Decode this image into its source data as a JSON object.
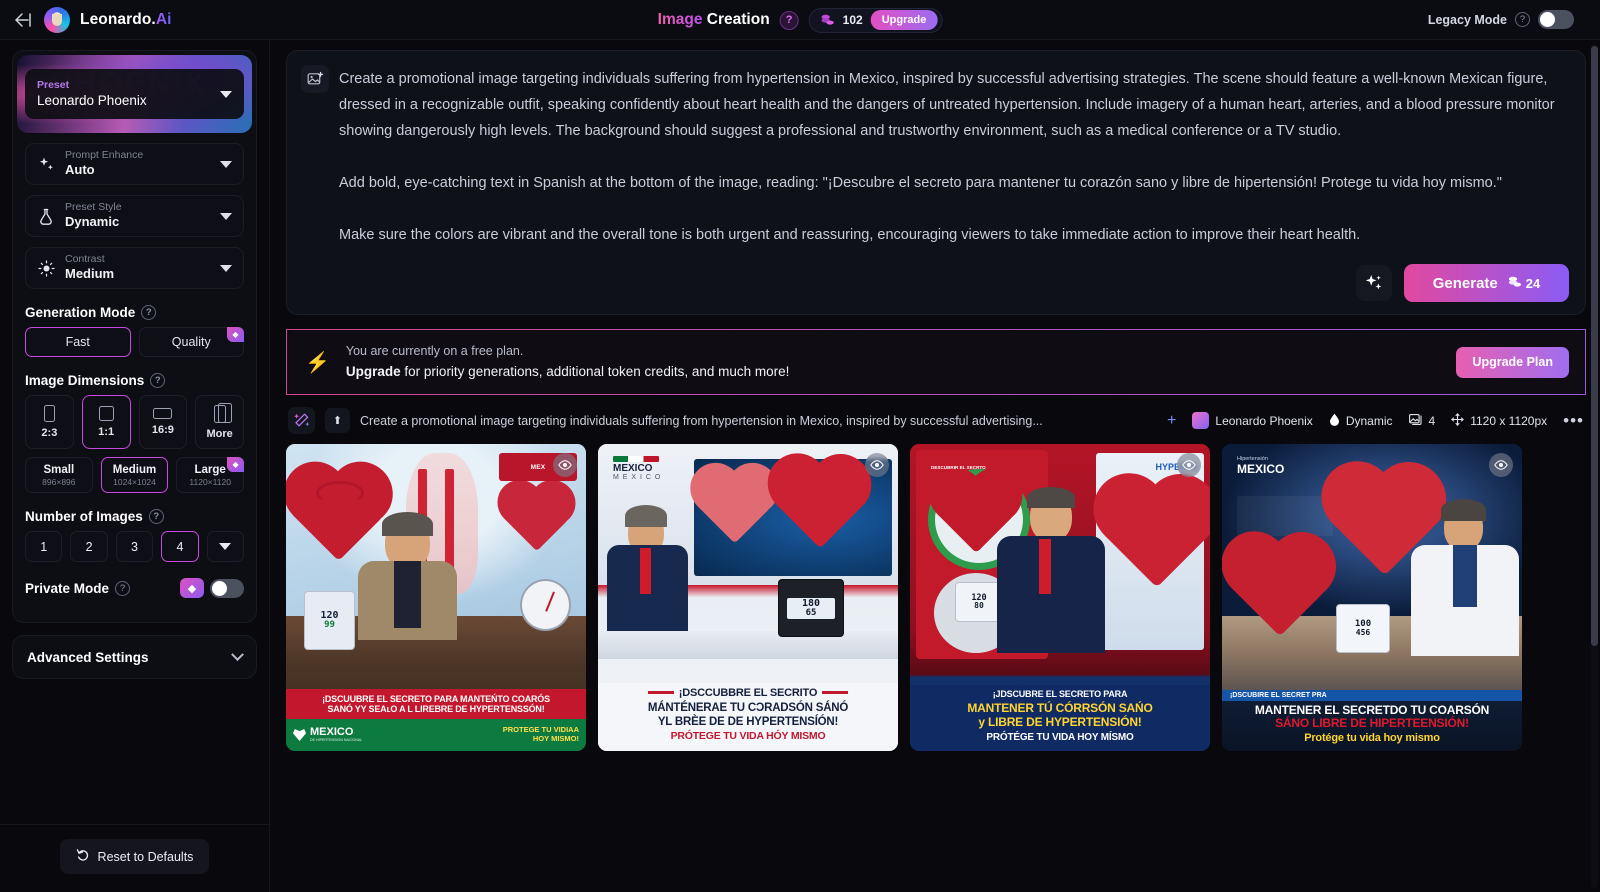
{
  "header": {
    "back_icon": "back-arrow-icon",
    "brand_main": "Leonardo.",
    "brand_accent": "Ai",
    "title_accent": "Image",
    "title_rest": " Creation",
    "help_glyph": "?",
    "token_count": "102",
    "upgrade_label": "Upgrade",
    "legacy_label": "Legacy Mode",
    "legacy_help": "?",
    "legacy_on": false
  },
  "sidebar": {
    "preset": {
      "label": "Preset",
      "value": "Leonardo Phoenix",
      "hero_word": "PHOENIX"
    },
    "selects": [
      {
        "label": "Prompt Enhance",
        "value": "Auto",
        "icon": "sparkle-icon"
      },
      {
        "label": "Preset Style",
        "value": "Dynamic",
        "icon": "flask-icon"
      },
      {
        "label": "Contrast",
        "value": "Medium",
        "icon": "sun-icon"
      }
    ],
    "generation_mode": {
      "title": "Generation Mode",
      "help": "?",
      "options": [
        {
          "label": "Fast",
          "selected": true,
          "premium": false
        },
        {
          "label": "Quality",
          "selected": false,
          "premium": true
        }
      ]
    },
    "image_dimensions": {
      "title": "Image Dimensions",
      "help": "?",
      "ratios": [
        {
          "label": "2:3",
          "selected": false
        },
        {
          "label": "1:1",
          "selected": true
        },
        {
          "label": "16:9",
          "selected": false
        },
        {
          "label": "More",
          "selected": false
        }
      ],
      "sizes": [
        {
          "name": "Small",
          "px": "896×896",
          "selected": false,
          "premium": false
        },
        {
          "name": "Medium",
          "px": "1024×1024",
          "selected": true,
          "premium": false
        },
        {
          "name": "Large",
          "px": "1120×1120",
          "selected": false,
          "premium": true
        }
      ]
    },
    "number_of_images": {
      "title": "Number of Images",
      "help": "?",
      "options": [
        {
          "label": "1",
          "selected": false
        },
        {
          "label": "2",
          "selected": false
        },
        {
          "label": "3",
          "selected": false
        },
        {
          "label": "4",
          "selected": true
        }
      ],
      "more_caret": "caret-down-icon"
    },
    "private_mode": {
      "title": "Private Mode",
      "help": "?",
      "enabled": false,
      "premium_badge": "gem-icon"
    },
    "advanced_settings": {
      "title": "Advanced Settings",
      "chevron": "chevron-down-icon"
    },
    "reset": {
      "label": "Reset to Defaults",
      "icon": "undo-icon"
    }
  },
  "main": {
    "prompt_icon": "image-plus-icon",
    "prompt_text": "Create a promotional image targeting individuals suffering from hypertension in Mexico, inspired by successful advertising strategies. The scene should feature a well-known Mexican figure, dressed in a recognizable outfit, speaking confidently about heart health and the dangers of untreated hypertension. Include imagery of a human heart, arteries, and a blood pressure monitor showing dangerously high levels. The background should suggest a professional and trustworthy environment, such as a medical conference or a TV studio.\n\nAdd bold, eye-catching text in Spanish at the bottom of the image, reading: \"¡Descubre el secreto para mantener tu corazón sano y libre de hipertensión! Protege tu vida hoy mismo.\"\n\nMake sure the colors are vibrant and the overall tone is both urgent and reassuring, encouraging viewers to take immediate action to improve their heart health.",
    "enhance_icon": "sparkles-icon",
    "generate_label": "Generate",
    "generate_cost": "24",
    "generate_cost_icon": "coin-icon"
  },
  "free_banner": {
    "icon": "bolt-icon",
    "line1": "You are currently on a free plan.",
    "line2_bold": "Upgrade",
    "line2_rest": " for priority generations, additional token credits, and much more!",
    "button": "Upgrade Plan"
  },
  "generation_bar": {
    "wand_icon": "magic-wand-icon",
    "pin_icon": "pin-icon",
    "prompt_preview": "Create a promotional image targeting individuals suffering from hypertension in Mexico, inspired by successful advertising...",
    "add_icon": "plus-icon",
    "model_name": "Leonardo Phoenix",
    "style_icon": "droplet-icon",
    "style_name": "Dynamic",
    "count_icon": "images-icon",
    "count": "4",
    "size_icon": "resize-icon",
    "size": "1120 x 1120px",
    "more_icon": "more-dots-icon"
  },
  "results": {
    "eye_icon": "eye-icon",
    "items": [
      {
        "id": "result-1",
        "caption_line1": "¡DSCUUBRE EL SECRETO PARA MANTEŃTO COARÓS",
        "caption_line2": "SANÓ YY SEAʟO A L LIREBRE DE HYPERTENSSÓN!",
        "footer_brand": "MEXICO",
        "footer_sub": "DE HIPERTENSION NACIONAL",
        "footer_cta1": "PROTEGE TU VIDIAA",
        "footer_cta2": "HOY MISMO!",
        "badge_text": "MEX",
        "bp_systolic": "120",
        "bp_diastolic": "99"
      },
      {
        "id": "result-2",
        "logo_top": "MEXICO",
        "logo_sub": "M E X I C O",
        "caption_line1": "¡DSCCUBBRE EL SECRITO",
        "caption_line2": "MÁNTÉNERAE TU CƆRADSÓN SÁNÓ",
        "caption_line3": "YL BRÈE DE DE HYPERTENSÍÓN!",
        "caption_line4": "PRÓTEGE TU VIDA HÓY MISMO",
        "bp_systolic": "180",
        "bp_diastolic": "65"
      },
      {
        "id": "result-3",
        "badge_text": "HYPERTE",
        "ring_label_top": "DESCUBRIR EL SECRTO",
        "caption_line1": "¡JDSCUBRE EL SECRETO PARA",
        "caption_line2": "MANTENER TÚ CÓRRSÓN SAŃO",
        "caption_line3": "y LIBRE DE HYPERTENSIÓN!",
        "caption_line4": "PRÓTÉGE TU VIDA HOY MÍSMO",
        "bp_systolic": "120",
        "bp_diastolic": "80"
      },
      {
        "id": "result-4",
        "logo_top": "Hipertensión",
        "logo_main": "MEXICO",
        "caption_tag": "¡DSCUBIRE EL SECRET PRA",
        "caption_line1": "MANTENER EL SECRETDO TU COARSÓN",
        "caption_line2": "SÁNO LIBRE DE HIPERTEENSIÓN!",
        "caption_line3": "Protége tu vida hoy mismo",
        "bp_systolic": "100",
        "bp_diastolic": "456"
      }
    ]
  }
}
